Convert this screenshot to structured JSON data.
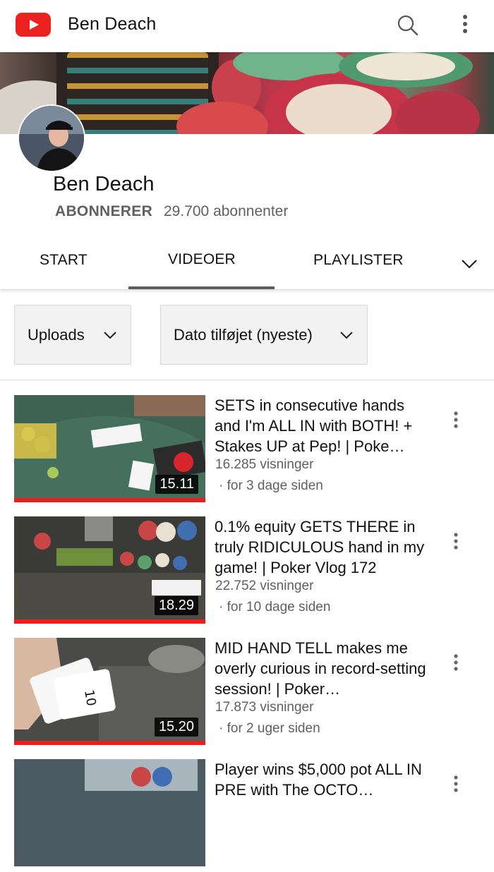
{
  "header": {
    "title": "Ben Deach",
    "logo_icon": "youtube-logo-icon",
    "search_icon": "search-icon",
    "menu_icon": "more-vert-icon"
  },
  "channel": {
    "name": "Ben Deach",
    "subscribe_label": "ABONNERER",
    "subscribers": "29.700 abonnenter"
  },
  "tabs": [
    {
      "label": "START",
      "active": false
    },
    {
      "label": "VIDEOER",
      "active": true
    },
    {
      "label": "PLAYLISTER",
      "active": false
    }
  ],
  "filters": {
    "uploads": "Uploads",
    "sort": "Dato tilføjet (nyeste)"
  },
  "videos": [
    {
      "title": "SETS in consecutive hands and I'm ALL IN with BOTH! + Stakes UP at Pep! | Poke…",
      "views": "16.285 visninger",
      "age": "· for 3 dage siden",
      "duration": "15.11",
      "progress": 1.0
    },
    {
      "title": "0.1% equity GETS THERE in truly RIDICULOUS hand in my game! | Poker Vlog 172",
      "views": "22.752 visninger",
      "age": "· for 10 dage siden",
      "duration": "18.29",
      "progress": 1.0
    },
    {
      "title": "MID HAND TELL makes me overly curious in record-setting session! | Poker…",
      "views": "17.873 visninger",
      "age": "· for 2 uger siden",
      "duration": "15.20",
      "progress": 1.0
    },
    {
      "title": "Player wins $5,000 pot ALL IN PRE with The OCTO…",
      "views": "",
      "age": "",
      "duration": "",
      "progress": 0
    }
  ],
  "colors": {
    "brand_red": "#ee2121",
    "progress_red": "#ee1c1c",
    "secondary_text": "#606060"
  }
}
